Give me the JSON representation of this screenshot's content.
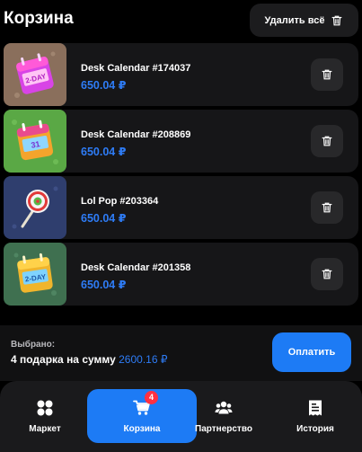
{
  "header": {
    "title": "Корзина",
    "clear_label": "Удалить всё"
  },
  "cart": {
    "items": [
      {
        "name": "Desk Calendar #174037",
        "price": "650.04 ₽",
        "image": "desk-calendar-pink",
        "background": "#8a6f5c",
        "icon": "calendar-icon"
      },
      {
        "name": "Desk Calendar #208869",
        "price": "650.04 ₽",
        "image": "desk-calendar-rainbow",
        "background": "#5aa845",
        "icon": "calendar-icon"
      },
      {
        "name": "Lol Pop #203364",
        "price": "650.04 ₽",
        "image": "lollipop",
        "background": "#2f3e6e",
        "icon": "lollipop-icon"
      },
      {
        "name": "Desk Calendar #201358",
        "price": "650.04 ₽",
        "image": "desk-calendar-gold",
        "background": "#3f7050",
        "icon": "calendar-icon"
      }
    ]
  },
  "summary": {
    "label": "Выбрано:",
    "count_text": "4 подарка на сумму",
    "total": "2600.16 ₽",
    "pay_label": "Оплатить"
  },
  "nav": {
    "items": [
      {
        "label": "Маркет",
        "icon": "grid-icon",
        "active": false
      },
      {
        "label": "Корзина",
        "icon": "cart-icon",
        "active": true,
        "badge": "4"
      },
      {
        "label": "Партнерство",
        "icon": "people-icon",
        "active": false
      },
      {
        "label": "История",
        "icon": "receipt-icon",
        "active": false
      }
    ]
  },
  "colors": {
    "accent": "#1d7bf5",
    "price": "#2e7cf6",
    "badge": "#ff3042",
    "card": "#161618"
  }
}
